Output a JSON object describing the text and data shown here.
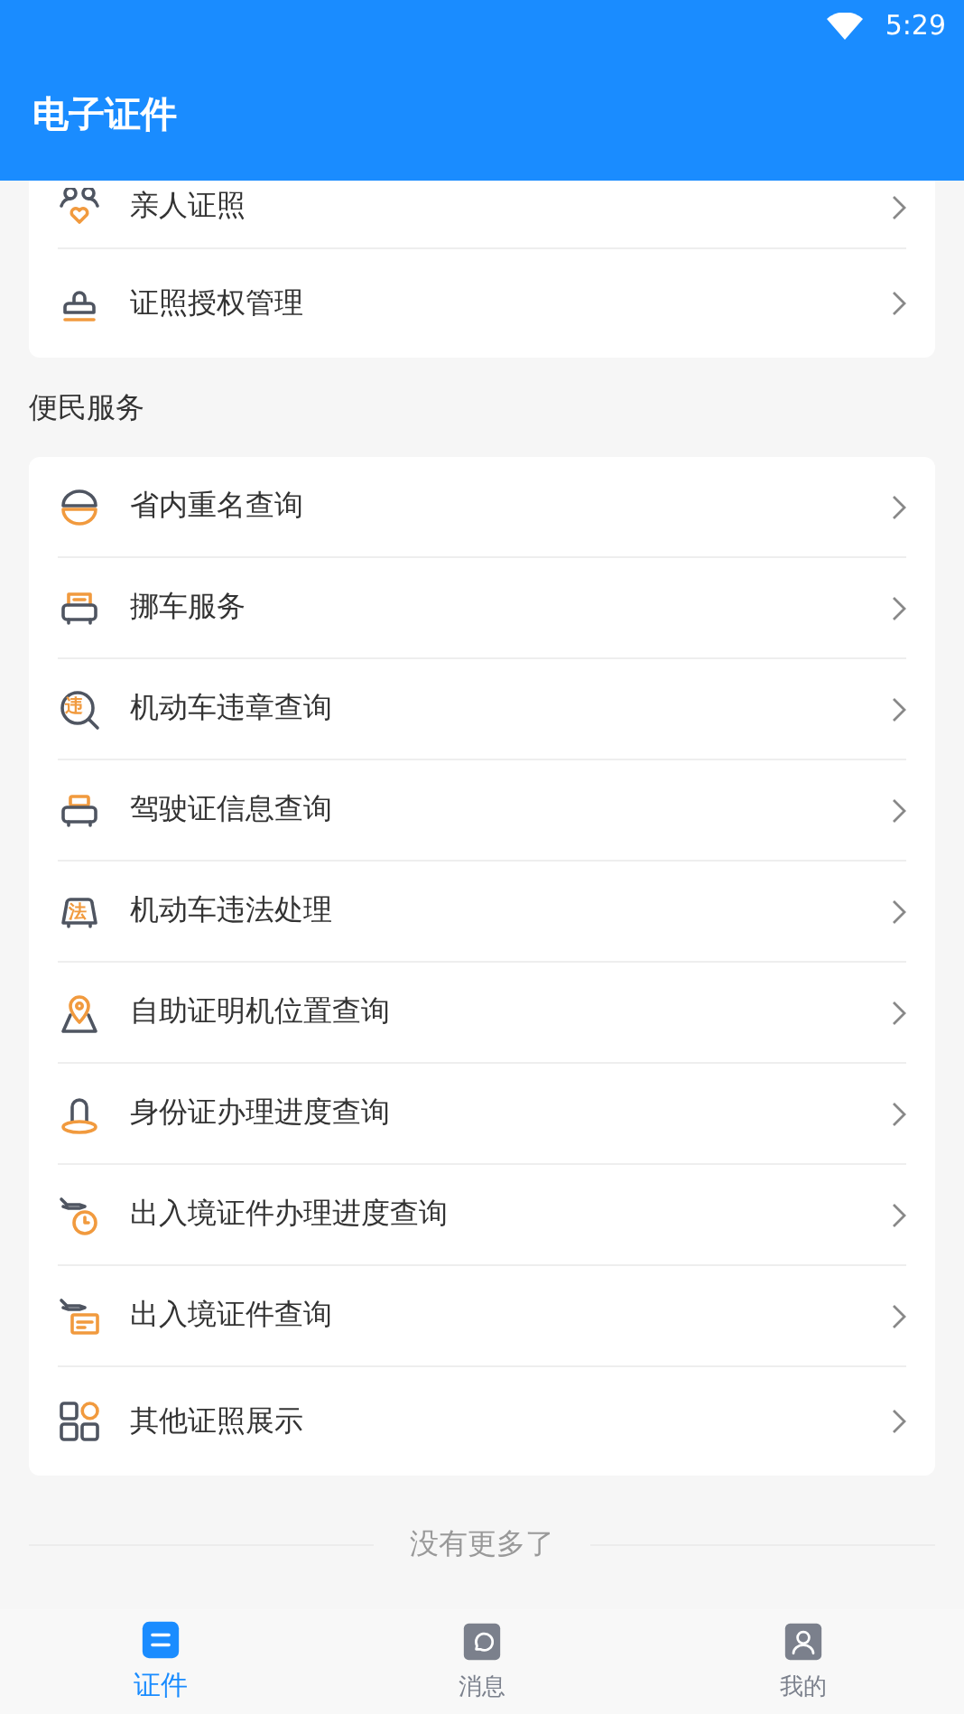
{
  "status_bar": {
    "time": "5:29"
  },
  "app_bar": {
    "title": "电子证件"
  },
  "sections": [
    {
      "items": [
        {
          "label": "亲人证照"
        },
        {
          "label": "证照授权管理"
        }
      ]
    },
    {
      "title": "便民服务",
      "items": [
        {
          "label": "省内重名查询"
        },
        {
          "label": "挪车服务"
        },
        {
          "label": "机动车违章查询",
          "icon_text": "违"
        },
        {
          "label": "驾驶证信息查询"
        },
        {
          "label": "机动车违法处理",
          "icon_text": "法"
        },
        {
          "label": "自助证明机位置查询"
        },
        {
          "label": "身份证办理进度查询"
        },
        {
          "label": "出入境证件办理进度查询"
        },
        {
          "label": "出入境证件查询"
        },
        {
          "label": "其他证照展示"
        }
      ]
    }
  ],
  "footer": "没有更多了",
  "tabs": [
    {
      "label": "证件",
      "selected": true
    },
    {
      "label": "消息",
      "selected": false
    },
    {
      "label": "我的",
      "selected": false
    }
  ]
}
